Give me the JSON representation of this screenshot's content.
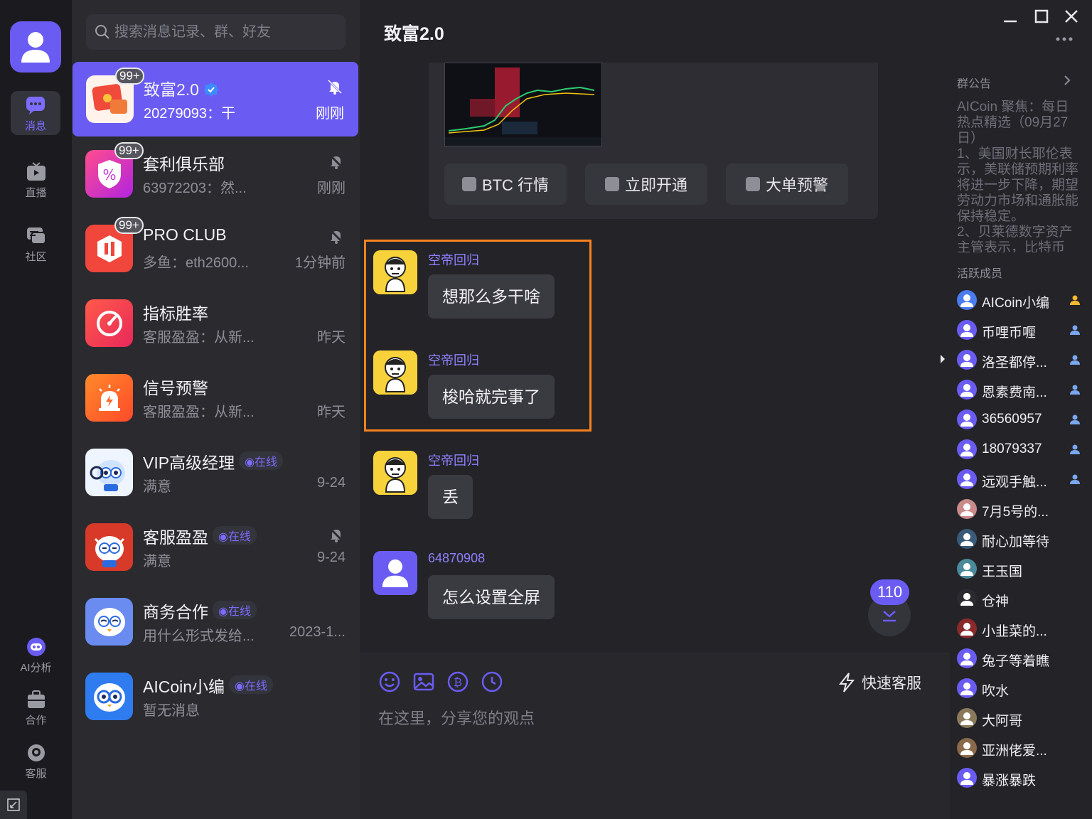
{
  "rail": {
    "items": [
      {
        "label": "消息"
      },
      {
        "label": "直播"
      },
      {
        "label": "社区"
      },
      {
        "label": "AI分析"
      },
      {
        "label": "合作"
      },
      {
        "label": "客服"
      }
    ]
  },
  "search": {
    "placeholder": "搜索消息记录、群、好友"
  },
  "conversations": [
    {
      "name": "致富2.0",
      "preview": "20279093：干",
      "time": "刚刚",
      "badge": "99+",
      "muted": true,
      "verified": true
    },
    {
      "name": "套利俱乐部",
      "preview": "63972203：然...",
      "time": "刚刚",
      "badge": "99+",
      "muted": true
    },
    {
      "name": "PRO CLUB",
      "preview": "多鱼：eth2600...",
      "time": "1分钟前",
      "badge": "99+",
      "muted": true
    },
    {
      "name": "指标胜率",
      "preview": "客服盈盈：从新...",
      "time": "昨天"
    },
    {
      "name": "信号预警",
      "preview": "客服盈盈：从新...",
      "time": "昨天"
    },
    {
      "name": "VIP高级经理",
      "preview": "满意",
      "time": "9-24",
      "status": "在线"
    },
    {
      "name": "客服盈盈",
      "preview": "满意",
      "time": "9-24",
      "status": "在线",
      "muted": true
    },
    {
      "name": "商务合作",
      "preview": "用什么形式发给...",
      "time": "2023-1...",
      "status": "在线"
    },
    {
      "name": "AICoin小编",
      "preview": "暂无消息",
      "time": "",
      "status": "在线"
    }
  ],
  "chat": {
    "title": "致富2.0",
    "card_buttons": [
      "BTC 行情",
      "立即开通",
      "大单预警"
    ],
    "messages": [
      {
        "sender": "空帝回归",
        "text": "想那么多干啥"
      },
      {
        "sender": "空帝回归",
        "text": "梭哈就完事了"
      },
      {
        "sender": "空帝回归",
        "text": "丢"
      },
      {
        "sender": "64870908",
        "text": "怎么设置全屏"
      }
    ],
    "unread_count": "110",
    "quick_service": "快速客服",
    "input_placeholder": "在这里，分享您的观点"
  },
  "sidebar": {
    "notice_title": "群公告",
    "notice_text": "AICoin 聚焦：每日热点精选（09月27日）\n1、美国财长耶伦表示，美联储预期利率将进一步下降，期望劳动力市场和通胀能保持稳定。\n2、贝莱德数字资产主管表示，比特币",
    "active_title": "活跃成员",
    "members": [
      {
        "name": "AICoin小编",
        "role": "admin"
      },
      {
        "name": "币哩币喱",
        "role": "member"
      },
      {
        "name": "洛圣都停...",
        "role": "member"
      },
      {
        "name": "恩素费南...",
        "role": "member"
      },
      {
        "name": "36560957",
        "role": "member"
      },
      {
        "name": "18079337",
        "role": "member"
      },
      {
        "name": "远观手触...",
        "role": "member"
      },
      {
        "name": "7月5号的..."
      },
      {
        "name": "耐心加等待"
      },
      {
        "name": "王玉国"
      },
      {
        "name": "仓神"
      },
      {
        "name": "小韭菜的..."
      },
      {
        "name": "兔子等着瞧"
      },
      {
        "name": "吹水"
      },
      {
        "name": "大阿哥"
      },
      {
        "name": "亚洲佬爱..."
      },
      {
        "name": "暴涨暴跌"
      }
    ]
  },
  "colors": {
    "accent": "#6a5cf2",
    "highlight": "#f5821f",
    "sender": "#8f80ff"
  }
}
